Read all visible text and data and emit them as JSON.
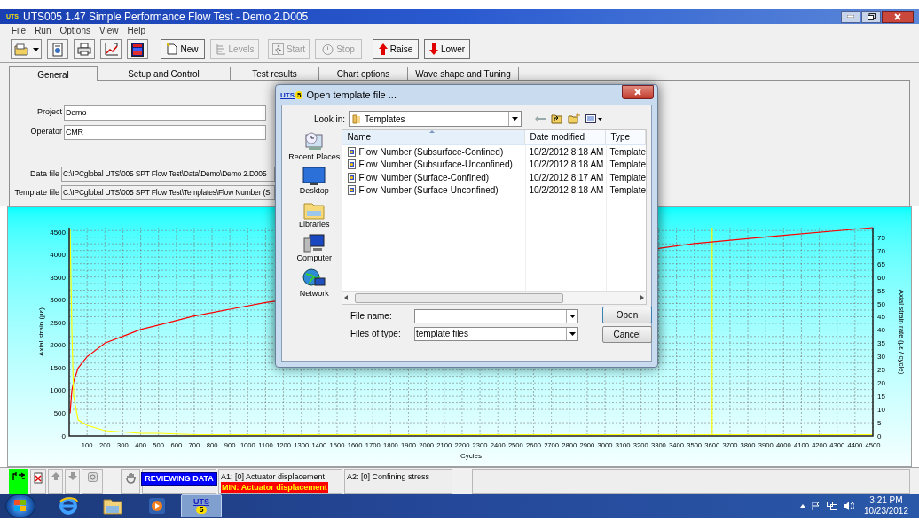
{
  "window": {
    "title": "UTS005 1.47 Simple Performance Flow Test - Demo 2.D005",
    "icon_label": "UTS"
  },
  "menu": [
    "File",
    "Run",
    "Options",
    "View",
    "Help"
  ],
  "toolbar": [
    {
      "label": "New",
      "disabled": false
    },
    {
      "label": "Levels",
      "disabled": true
    },
    {
      "label": "Start",
      "disabled": true
    },
    {
      "label": "Stop",
      "disabled": true
    },
    {
      "label": "Raise",
      "disabled": false
    },
    {
      "label": "Lower",
      "disabled": false
    }
  ],
  "tabs": [
    {
      "label": "General",
      "selected": true
    },
    {
      "label": "Setup and Control",
      "selected": false
    },
    {
      "label": "Test results",
      "selected": false
    },
    {
      "label": "Chart options",
      "selected": false
    },
    {
      "label": "Wave shape and Tuning",
      "selected": false
    }
  ],
  "fields": [
    {
      "label": "Project",
      "value": "Demo",
      "kind": "text"
    },
    {
      "label": "Operator",
      "value": "CMR",
      "kind": "text"
    },
    {
      "label": "Data file",
      "value": "C:\\IPCglobal UTS\\005 SPT Flow Test\\Data\\Demo\\Demo 2.D005",
      "kind": "path"
    },
    {
      "label": "Template file",
      "value": "C:\\IPCglobal UTS\\005 SPT Flow Test\\Templates\\Flow Number (S",
      "kind": "path"
    }
  ],
  "chart": {
    "chart_data": {
      "type": "line",
      "xlabel": "Cycles",
      "ylabel": "Axial strain (µε)",
      "y2label": "Axial strain rate (µε / cycle)",
      "x": [
        5,
        15,
        25,
        50,
        100,
        200,
        300,
        400,
        500,
        700,
        900,
        1100,
        1500,
        2000,
        2500,
        3000,
        3500,
        4000,
        4500
      ],
      "series": [
        {
          "color": "#ff0000",
          "values": [
            500,
            1000,
            1200,
            1500,
            1750,
            2050,
            2200,
            2350,
            2450,
            2650,
            2800,
            2950,
            null,
            null,
            null,
            null,
            4250,
            4430,
            4600
          ]
        },
        {
          "color": "#ffff00",
          "axis": "y2",
          "values": [
            78,
            40,
            15,
            6,
            4,
            2,
            1.5,
            1,
            1,
            0.5,
            0.5,
            0.5,
            0.5,
            0.5,
            0.5,
            0.5,
            0.5,
            0.5,
            0.5
          ]
        }
      ],
      "xlim": [
        0,
        4500
      ],
      "ylim": [
        0,
        4600
      ],
      "y2lim": [
        0,
        78.6
      ],
      "xticks": [
        100,
        200,
        300,
        400,
        500,
        600,
        700,
        800,
        900,
        1000,
        1100,
        1200,
        1300,
        1400,
        1500,
        1600,
        1700,
        1800,
        1900,
        2000,
        2100,
        2200,
        2300,
        2400,
        2500,
        2600,
        2700,
        2800,
        2900,
        3000,
        3100,
        3200,
        3300,
        3400,
        3500,
        3600,
        3700,
        3800,
        3900,
        4000,
        4100,
        4200,
        4300,
        4400,
        4500
      ],
      "yticks": [
        0,
        500,
        1000,
        1500,
        2000,
        2500,
        3000,
        3500,
        4000,
        4500
      ],
      "y2ticks": [
        0,
        5,
        10,
        15,
        20,
        25,
        30,
        35,
        40,
        45,
        50,
        55,
        60,
        65,
        70,
        75
      ],
      "grid": true,
      "ref_lines": [
        {
          "axis": "x",
          "value": 3600,
          "color": "#ffff00"
        }
      ]
    }
  },
  "dialog": {
    "title": "Open template file ...",
    "icon_label": "UTS",
    "icon_badge": "5",
    "look_in_label": "Look in:",
    "look_in": "Templates",
    "places": [
      {
        "label": "Recent Places",
        "kind": "recent"
      },
      {
        "label": "Desktop",
        "kind": "desktop"
      },
      {
        "label": "Libraries",
        "kind": "libraries"
      },
      {
        "label": "Computer",
        "kind": "computer"
      },
      {
        "label": "Network",
        "kind": "network"
      }
    ],
    "columns": [
      "Name",
      "Date modified",
      "Type"
    ],
    "files": [
      {
        "name": "Flow Number (Subsurface-Confined)",
        "date": "10/2/2012 8:18 AM",
        "type": "Template"
      },
      {
        "name": "Flow Number (Subsurface-Unconfined)",
        "date": "10/2/2012 8:18 AM",
        "type": "Template"
      },
      {
        "name": "Flow Number (Surface-Confined)",
        "date": "10/2/2012 8:17 AM",
        "type": "Template"
      },
      {
        "name": "Flow Number (Surface-Unconfined)",
        "date": "10/2/2012 8:18 AM",
        "type": "Template"
      }
    ],
    "file_name_label": "File name:",
    "file_type_label": "Files of type:",
    "file_type": "template files",
    "buttons": [
      "Open",
      "Cancel"
    ]
  },
  "status_bar": {
    "mode": "REVIEWING DATA",
    "channels": [
      {
        "text": "A1: [0] Actuator displacement",
        "alarm": "MIN: Actuator displacement"
      },
      {
        "text": "A2: [0] Confining stress"
      }
    ]
  },
  "taskbar": {
    "apps": [
      {
        "kind": "browser",
        "selected": false
      },
      {
        "kind": "folder",
        "selected": false
      },
      {
        "kind": "player",
        "selected": false
      },
      {
        "kind": "uts",
        "selected": true,
        "label": "UTS",
        "badge": "5"
      }
    ],
    "clock": {
      "time": "3:21 PM",
      "date": "10/23/2012"
    }
  }
}
